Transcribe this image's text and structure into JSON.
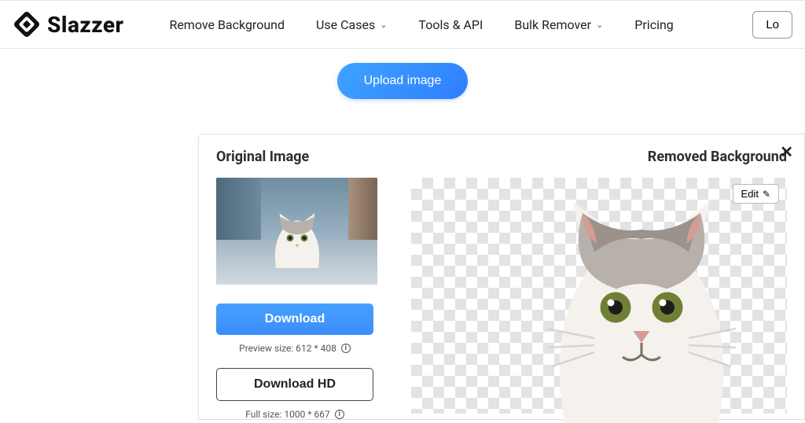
{
  "brand": {
    "name": "Slazzer"
  },
  "nav": {
    "remove_bg": "Remove Background",
    "use_cases": "Use Cases",
    "tools_api": "Tools & API",
    "bulk": "Bulk Remover",
    "pricing": "Pricing",
    "login": "Lo"
  },
  "upload": {
    "label": "Upload image"
  },
  "card": {
    "original_heading": "Original Image",
    "removed_heading": "Removed Background",
    "download_label": "Download",
    "preview_size": "Preview size: 612 * 408",
    "download_hd_label": "Download HD",
    "full_size": "Full size: 1000 * 667",
    "edit_label": "Edit"
  }
}
